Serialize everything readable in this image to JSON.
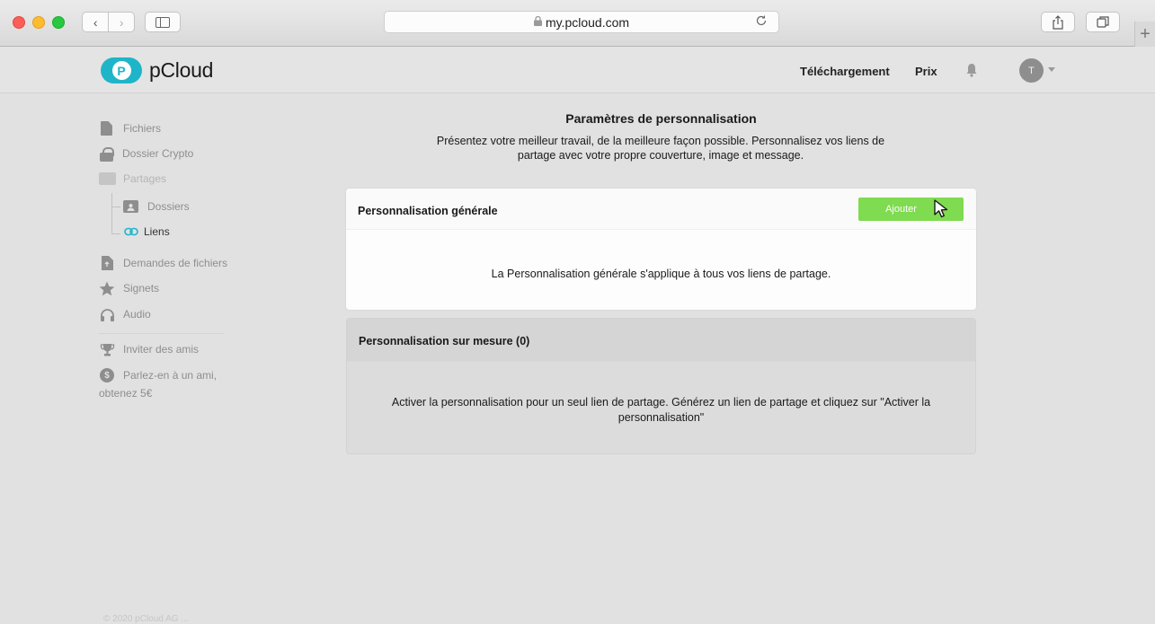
{
  "browser": {
    "url": "my.pcloud.com",
    "back_glyph": "‹",
    "forward_glyph": "›",
    "new_tab_glyph": "+"
  },
  "header": {
    "logo_letter": "P",
    "logo_text": "pCloud",
    "download_link": "Téléchargement",
    "price_link": "Prix",
    "avatar_initial": "T"
  },
  "sidebar": {
    "files": "Fichiers",
    "crypto": "Dossier Crypto",
    "shares": "Partages",
    "folders": "Dossiers",
    "links": "Liens",
    "file_requests": "Demandes de fichiers",
    "bookmarks": "Signets",
    "audio": "Audio",
    "invite": "Inviter des amis",
    "promo_line1": "Parlez-en à un ami,",
    "promo_line2": "obtenez 5€",
    "footer": "© 2020 pCloud AG ..."
  },
  "main": {
    "title": "Paramètres de personnalisation",
    "subtitle": "Présentez votre meilleur travail, de la meilleure façon possible. Personnalisez vos liens de partage avec votre propre couverture, image et message.",
    "general": {
      "title": "Personnalisation générale",
      "add_button": "Ajouter",
      "description": "La Personnalisation générale s'applique à tous vos liens de partage."
    },
    "custom": {
      "title": "Personnalisation sur mesure (0)",
      "description": "Activer la personnalisation pour un seul lien de partage. Générez un lien de partage et cliquez sur \"Activer la personnalisation\""
    }
  },
  "colors": {
    "accent": "#1fb5c9",
    "add_button": "#7fdb50"
  }
}
